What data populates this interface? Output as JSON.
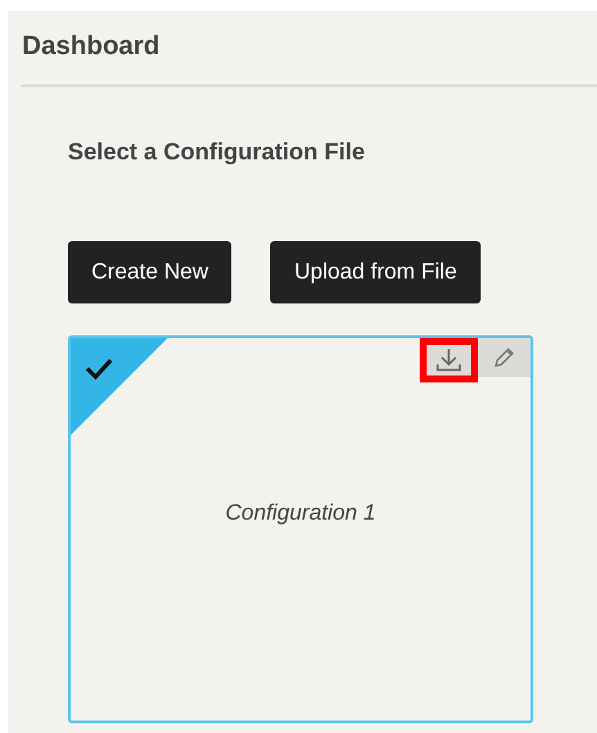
{
  "header": {
    "title": "Dashboard"
  },
  "section": {
    "title": "Select a Configuration File"
  },
  "buttons": [
    "Create New",
    "Upload from File"
  ],
  "configurations": [
    {
      "name": "Configuration 1",
      "selected": true,
      "actions": [
        {
          "kind": "download",
          "highlighted": true
        },
        {
          "kind": "edit",
          "highlighted": false
        }
      ]
    }
  ]
}
